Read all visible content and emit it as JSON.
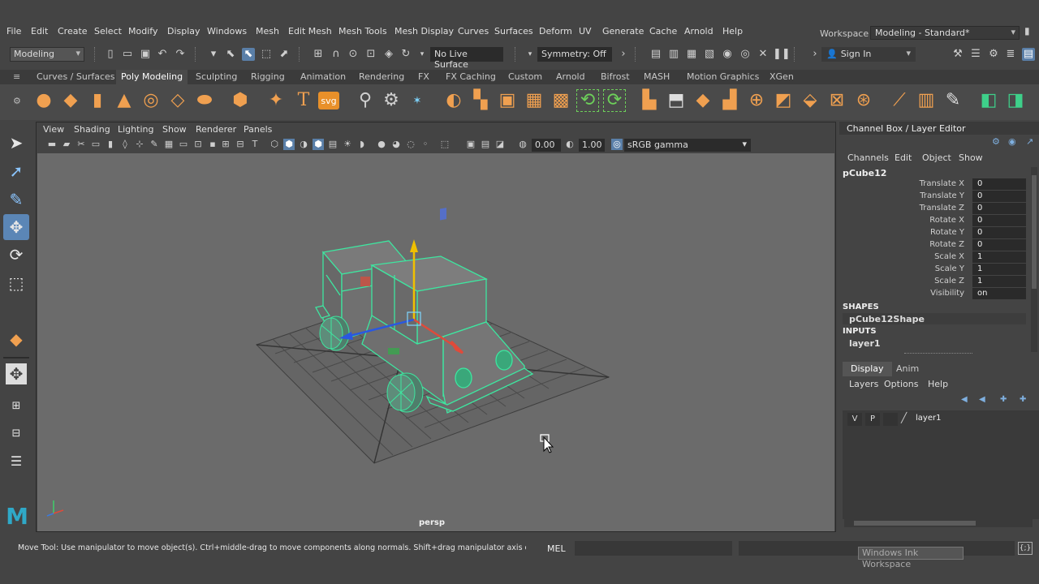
{
  "menu": [
    "File",
    "Edit",
    "Create",
    "Select",
    "Modify",
    "Display",
    "Windows",
    "Mesh",
    "Edit Mesh",
    "Mesh Tools",
    "Mesh Display",
    "Curves",
    "Surfaces",
    "Deform",
    "UV",
    "Generate",
    "Cache",
    "Arnold",
    "Help"
  ],
  "workspace": {
    "label": "Workspace :",
    "value": "Modeling - Standard*"
  },
  "status": {
    "mode": "Modeling",
    "live_surface": "No Live Surface",
    "symmetry": "Symmetry: Off",
    "sign_in": "Sign In"
  },
  "shelf": {
    "tabs": [
      "Curves / Surfaces",
      "Poly Modeling",
      "Sculpting",
      "Rigging",
      "Animation",
      "Rendering",
      "FX",
      "FX Caching",
      "Custom",
      "Arnold",
      "Bifrost",
      "MASH",
      "Motion Graphics",
      "XGen"
    ],
    "active_tab": "Poly Modeling",
    "text_icons": {
      "type_tool": "T",
      "svg_tool": "svg"
    }
  },
  "viewport": {
    "menu": [
      "View",
      "Shading",
      "Lighting",
      "Show",
      "Renderer",
      "Panels"
    ],
    "exposure": "0.00",
    "gamma": "1.00",
    "color_space": "sRGB gamma",
    "camera": "persp"
  },
  "channel_box": {
    "title": "Channel Box / Layer Editor",
    "menu": [
      "Channels",
      "Edit",
      "Object",
      "Show"
    ],
    "object": "pCube12",
    "attributes": [
      {
        "name": "Translate X",
        "value": "0"
      },
      {
        "name": "Translate Y",
        "value": "0"
      },
      {
        "name": "Translate Z",
        "value": "0"
      },
      {
        "name": "Rotate X",
        "value": "0"
      },
      {
        "name": "Rotate Y",
        "value": "0"
      },
      {
        "name": "Rotate Z",
        "value": "0"
      },
      {
        "name": "Scale X",
        "value": "1"
      },
      {
        "name": "Scale Y",
        "value": "1"
      },
      {
        "name": "Scale Z",
        "value": "1"
      },
      {
        "name": "Visibility",
        "value": "on"
      }
    ],
    "shapes_header": "SHAPES",
    "shape": "pCube12Shape",
    "inputs_header": "INPUTS",
    "input": "layer1"
  },
  "layer_editor": {
    "tabs": [
      "Display",
      "Anim"
    ],
    "active_tab": "Display",
    "menu": [
      "Layers",
      "Options",
      "Help"
    ],
    "layers": [
      {
        "v": "V",
        "p": "P",
        "name": "layer1"
      }
    ]
  },
  "help_line": {
    "text": "Move Tool: Use manipulator to move object(s). Ctrl+middle-drag to move components along normals. Shift+drag manipulator axis or plane handles to e",
    "mel": "MEL",
    "tooltip": "Windows Ink Workspace"
  },
  "colors": {
    "accent": "#5b86b6",
    "shelf_orange": "#f0a050",
    "wire_green": "#3ee6a0",
    "viewport_bg": "#6b6b6b",
    "axis_x": "#e04a3a",
    "axis_y": "#f0c000",
    "axis_z": "#2a58e0"
  }
}
